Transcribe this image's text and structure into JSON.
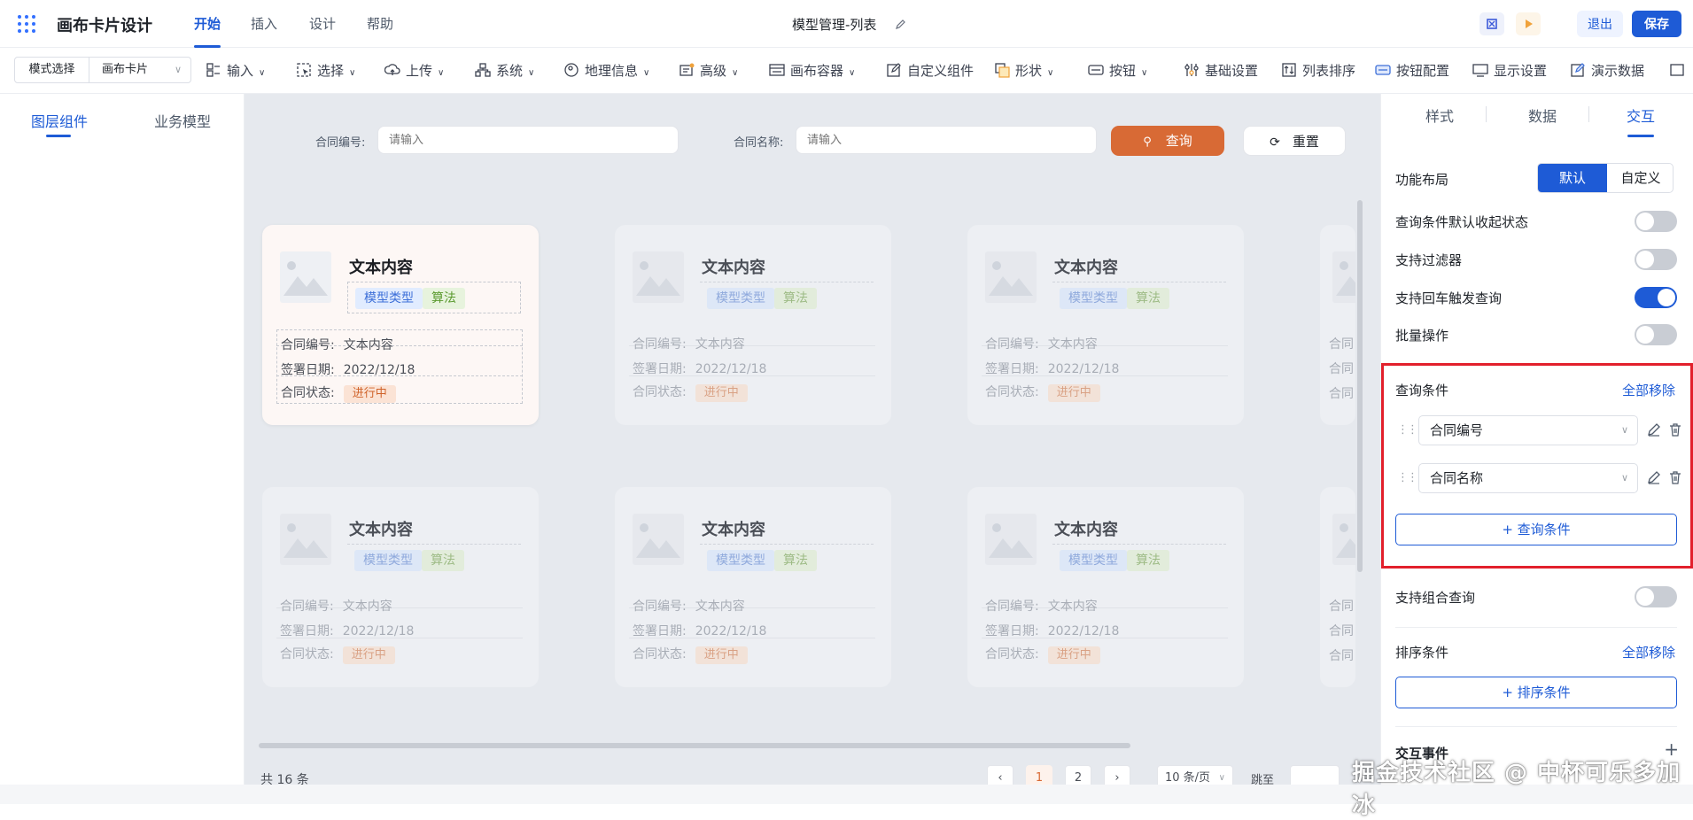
{
  "app": {
    "title": "画布卡片设计"
  },
  "menu": [
    "开始",
    "插入",
    "设计",
    "帮助"
  ],
  "doc_title": "模型管理-列表",
  "header_buttons": {
    "exit": "退出",
    "save": "保存"
  },
  "toolbar": {
    "mode_label": "模式选择",
    "mode_value": "画布卡片",
    "items": [
      "输入",
      "选择",
      "上传",
      "系统",
      "地理信息",
      "高级",
      "画布容器",
      "自定义组件",
      "形状",
      "按钮",
      "基础设置",
      "列表排序",
      "按钮配置",
      "显示设置",
      "演示数据"
    ]
  },
  "left_tabs": [
    "图层组件",
    "业务模型"
  ],
  "query": {
    "field1_label": "合同编号:",
    "field2_label": "合同名称:",
    "placeholder": "请输入",
    "search_label": "查询",
    "reset_label": "重置"
  },
  "card": {
    "title": "文本内容",
    "tag1": "模型类型",
    "tag2": "算法",
    "row1_label": "合同编号:",
    "row1_value": "文本内容",
    "row2_label": "签署日期:",
    "row2_value": "2022/12/18",
    "row3_label": "合同状态:",
    "status": "进行中"
  },
  "partial_label": "合同",
  "pagination": {
    "total": "共 16 条",
    "pages": [
      "1",
      "2"
    ],
    "page_size": "10 条/页",
    "jump": "跳至"
  },
  "right_tabs": [
    "样式",
    "数据",
    "交互"
  ],
  "settings": {
    "layout_label": "功能布局",
    "layout_opts": [
      "默认",
      "自定义"
    ],
    "toggles": [
      {
        "label": "查询条件默认收起状态",
        "on": false
      },
      {
        "label": "支持过滤器",
        "on": false
      },
      {
        "label": "支持回车触发查询",
        "on": true
      },
      {
        "label": "批量操作",
        "on": false
      }
    ],
    "query_cond_title": "查询条件",
    "remove_all": "全部移除",
    "conditions": [
      "合同编号",
      "合同名称"
    ],
    "add_query": "+ 查询条件",
    "combo_label": "支持组合查询",
    "combo_on": false,
    "sort_title": "排序条件",
    "sort_remove_all": "全部移除",
    "add_sort": "+ 排序条件",
    "events_title": "交互事件",
    "plus": "+"
  },
  "watermark": "掘金技术社区 @ 中杯可乐多加冰"
}
